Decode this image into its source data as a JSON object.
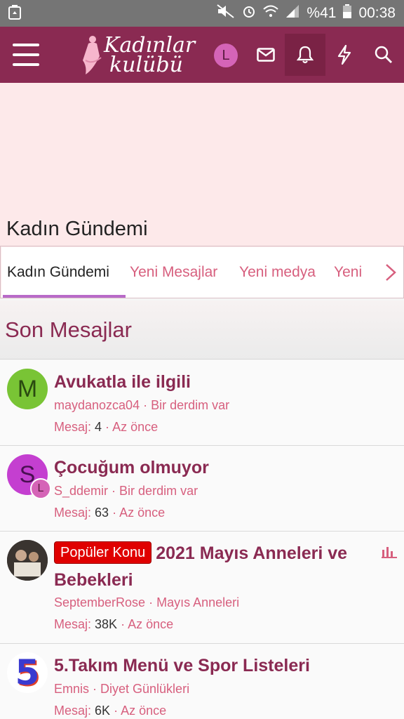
{
  "statusbar": {
    "battery": "%41",
    "time": "00:38"
  },
  "header": {
    "logo_line1": "Kadınlar",
    "logo_line2": "kulübü",
    "avatar_letter": "L"
  },
  "banner": {
    "title": "Kadın Gündemi"
  },
  "tabs": [
    {
      "label": "Kadın Gündemi"
    },
    {
      "label": "Yeni Mesajlar"
    },
    {
      "label": "Yeni medya"
    },
    {
      "label": "Yeni"
    }
  ],
  "section": {
    "title": "Son Mesajlar"
  },
  "posts": [
    {
      "avatar_letter": "M",
      "title": "Avukatla ile ilgili",
      "author": "maydanozca04",
      "forum": "Bir derdim var",
      "replies_label": "Mesaj:",
      "replies": "4",
      "time": "Az önce"
    },
    {
      "avatar_letter": "S",
      "sub_avatar_letter": "L",
      "title": "Çocuğum olmuyor",
      "author": "S_ddemir",
      "forum": "Bir derdim var",
      "replies_label": "Mesaj:",
      "replies": "63",
      "time": "Az önce"
    },
    {
      "badge": "Popüler Konu",
      "title": "2021 Mayıs Anneleri ve Bebekleri",
      "author": "SeptemberRose",
      "forum": "Mayıs Anneleri",
      "replies_label": "Mesaj:",
      "replies": "38K",
      "time": "Az önce"
    },
    {
      "avatar_letter": "5",
      "title": "5.Takım Menü ve Spor Listeleri",
      "author": "Emnis",
      "forum": "Diyet Günlükleri",
      "replies_label": "Mesaj:",
      "replies": "6K",
      "time": "Az önce"
    }
  ],
  "colors": {
    "brand": "#8a2a52",
    "accent": "#d75f7e",
    "banner_bg": "#fde9ea",
    "tab_underline": "#b86ac8"
  }
}
